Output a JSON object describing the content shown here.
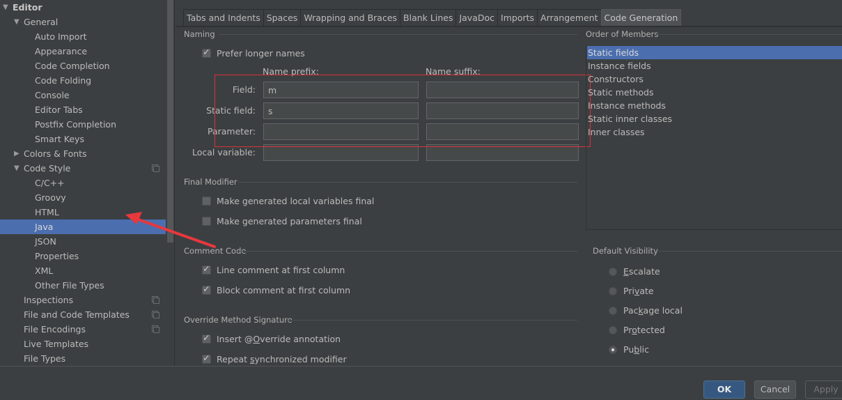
{
  "sidebar": {
    "items": [
      {
        "label": "Editor",
        "level": 0,
        "arrow": "▼",
        "bold": true
      },
      {
        "label": "General",
        "level": 1,
        "arrow": "▼"
      },
      {
        "label": "Auto Import",
        "level": 2
      },
      {
        "label": "Appearance",
        "level": 2
      },
      {
        "label": "Code Completion",
        "level": 2
      },
      {
        "label": "Code Folding",
        "level": 2
      },
      {
        "label": "Console",
        "level": 2
      },
      {
        "label": "Editor Tabs",
        "level": 2
      },
      {
        "label": "Postfix Completion",
        "level": 2
      },
      {
        "label": "Smart Keys",
        "level": 2
      },
      {
        "label": "Colors & Fonts",
        "level": 1,
        "arrow": "▶"
      },
      {
        "label": "Code Style",
        "level": 1,
        "arrow": "▼",
        "copy_icon": true
      },
      {
        "label": "C/C++",
        "level": 2
      },
      {
        "label": "Groovy",
        "level": 2
      },
      {
        "label": "HTML",
        "level": 2
      },
      {
        "label": "Java",
        "level": 2,
        "selected": true
      },
      {
        "label": "JSON",
        "level": 2
      },
      {
        "label": "Properties",
        "level": 2
      },
      {
        "label": "XML",
        "level": 2
      },
      {
        "label": "Other File Types",
        "level": 2
      },
      {
        "label": "Inspections",
        "level": 1,
        "copy_icon": true
      },
      {
        "label": "File and Code Templates",
        "level": 1,
        "copy_icon": true
      },
      {
        "label": "File Encodings",
        "level": 1,
        "copy_icon": true
      },
      {
        "label": "Live Templates",
        "level": 1
      },
      {
        "label": "File Types",
        "level": 1
      }
    ]
  },
  "tabs": [
    {
      "label": "Tabs and Indents"
    },
    {
      "label": "Spaces"
    },
    {
      "label": "Wrapping and Braces"
    },
    {
      "label": "Blank Lines"
    },
    {
      "label": "JavaDoc"
    },
    {
      "label": "Imports"
    },
    {
      "label": "Arrangement"
    },
    {
      "label": "Code Generation",
      "active": true
    }
  ],
  "naming": {
    "title": "Naming",
    "prefer_longer_names": {
      "label": "Prefer longer names",
      "checked": true
    },
    "prefix_header": "Name prefix:",
    "suffix_header": "Name suffix:",
    "rows": [
      {
        "label": "Field:",
        "prefix": "m",
        "suffix": ""
      },
      {
        "label": "Static field:",
        "prefix": "s",
        "suffix": ""
      },
      {
        "label": "Parameter:",
        "prefix": "",
        "suffix": ""
      },
      {
        "label": "Local variable:",
        "prefix": "",
        "suffix": ""
      }
    ]
  },
  "final_modifier": {
    "title": "Final Modifier",
    "options": [
      {
        "label": "Make generated local variables final",
        "checked": false
      },
      {
        "label": "Make generated parameters final",
        "checked": false
      }
    ]
  },
  "comment_code": {
    "title": "Comment Code",
    "options": [
      {
        "label": "Line comment at first column",
        "checked": true
      },
      {
        "label": "Block comment at first column",
        "checked": true
      }
    ]
  },
  "override_signature": {
    "title": "Override Method Signature",
    "options": [
      {
        "label_html": "Insert @<u>O</u>verride annotation",
        "label": "Insert @Override annotation",
        "checked": true
      },
      {
        "label_html": "Repeat <u>s</u>ynchronized modifier",
        "label": "Repeat synchronized modifier",
        "checked": true
      }
    ]
  },
  "order_of_members": {
    "title": "Order of Members",
    "items": [
      {
        "label": "Static fields",
        "selected": true
      },
      {
        "label": "Instance fields"
      },
      {
        "label": "Constructors"
      },
      {
        "label": "Static methods"
      },
      {
        "label": "Instance methods"
      },
      {
        "label": "Static inner classes"
      },
      {
        "label": "Inner classes"
      }
    ]
  },
  "default_visibility": {
    "title": "Default Visibility",
    "options": [
      {
        "label": "Escalate",
        "label_html": "<u>E</u>scalate",
        "checked": false
      },
      {
        "label": "Private",
        "label_html": "Pri<u>v</u>ate",
        "checked": false
      },
      {
        "label": "Package local",
        "label_html": "Pac<u>k</u>age local",
        "checked": false
      },
      {
        "label": "Protected",
        "label_html": "Pr<u>o</u>tected",
        "checked": false
      },
      {
        "label": "Public",
        "label_html": "Pu<u>b</u>lic",
        "checked": true
      }
    ]
  },
  "buttons": {
    "ok": "OK",
    "cancel": "Cancel",
    "apply": "Apply"
  },
  "annotations": {
    "highlight_color": "#d9323c",
    "arrow_color": "#e8383d"
  }
}
